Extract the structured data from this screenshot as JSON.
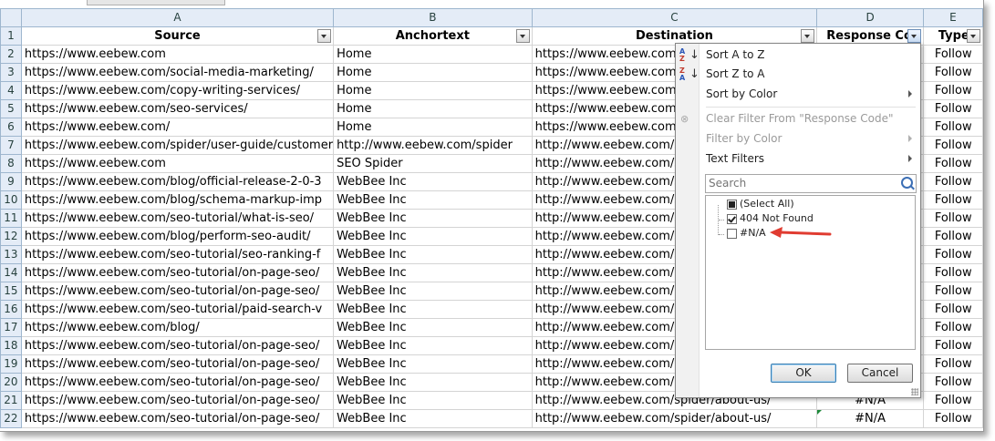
{
  "columns": [
    "",
    "A",
    "B",
    "C",
    "D",
    "E"
  ],
  "header_row": {
    "number": "1",
    "source": "Source",
    "anchortext": "Anchortext",
    "destination": "Destination",
    "response_code": "Response Cod",
    "type": "Type"
  },
  "rows": [
    {
      "n": "2",
      "a": "https://www.eebew.com",
      "b": "Home",
      "c": "https://www.eebew.com/",
      "d": "",
      "e": "Follow"
    },
    {
      "n": "3",
      "a": "https://www.eebew.com/social-media-marketing/",
      "b": "Home",
      "c": "https://www.eebew.com/",
      "d": "",
      "e": "Follow"
    },
    {
      "n": "4",
      "a": "https://www.eebew.com/copy-writing-services/",
      "b": "Home",
      "c": "https://www.eebew.com/",
      "d": "",
      "e": "Follow"
    },
    {
      "n": "5",
      "a": "https://www.eebew.com/seo-services/",
      "b": "Home",
      "c": "https://www.eebew.com/",
      "d": "",
      "e": "Follow"
    },
    {
      "n": "6",
      "a": "https://www.eebew.com/",
      "b": "Home",
      "c": "https://www.eebew.com/",
      "d": "",
      "e": "Follow"
    },
    {
      "n": "7",
      "a": "https://www.eebew.com/spider/user-guide/customer",
      "b": "http://www.eebew.com/spider",
      "c": "http://www.eebew.com/s",
      "d": "",
      "e": "Follow"
    },
    {
      "n": "8",
      "a": "https://www.eebew.com",
      "b": "SEO Spider",
      "c": "http://www.eebew.com/s",
      "d": "",
      "e": "Follow"
    },
    {
      "n": "9",
      "a": "https://www.eebew.com/blog/official-release-2-0-3",
      "b": "WebBee Inc",
      "c": "http://www.eebew.com/s",
      "d": "",
      "e": "Follow"
    },
    {
      "n": "10",
      "a": "https://www.eebew.com/blog/schema-markup-imp",
      "b": "WebBee Inc",
      "c": "http://www.eebew.com/s",
      "d": "",
      "e": "Follow"
    },
    {
      "n": "11",
      "a": "https://www.eebew.com/seo-tutorial/what-is-seo/",
      "b": "WebBee Inc",
      "c": "http://www.eebew.com/s",
      "d": "",
      "e": "Follow"
    },
    {
      "n": "12",
      "a": "https://www.eebew.com/blog/perform-seo-audit/",
      "b": "WebBee Inc",
      "c": "http://www.eebew.com/s",
      "d": "",
      "e": "Follow"
    },
    {
      "n": "13",
      "a": "https://www.eebew.com/seo-tutorial/seo-ranking-f",
      "b": "WebBee Inc",
      "c": "http://www.eebew.com/s",
      "d": "",
      "e": "Follow"
    },
    {
      "n": "14",
      "a": "https://www.eebew.com/seo-tutorial/on-page-seo/",
      "b": "WebBee Inc",
      "c": "http://www.eebew.com/",
      "d": "",
      "e": "Follow"
    },
    {
      "n": "15",
      "a": "https://www.eebew.com/seo-tutorial/on-page-seo/",
      "b": "WebBee Inc",
      "c": "http://www.eebew.com/",
      "d": "",
      "e": "Follow"
    },
    {
      "n": "16",
      "a": "https://www.eebew.com/seo-tutorial/paid-search-v",
      "b": "WebBee Inc",
      "c": "http://www.eebew.com/s",
      "d": "",
      "e": "Follow"
    },
    {
      "n": "17",
      "a": "https://www.eebew.com/blog/",
      "b": "WebBee Inc",
      "c": "http://www.eebew.com/s",
      "d": "",
      "e": "Follow"
    },
    {
      "n": "18",
      "a": "https://www.eebew.com/seo-tutorial/on-page-seo/",
      "b": "WebBee Inc",
      "c": "http://www.eebew.com/",
      "d": "",
      "e": "Follow"
    },
    {
      "n": "19",
      "a": "https://www.eebew.com/seo-tutorial/on-page-seo/",
      "b": "WebBee Inc",
      "c": "http://www.eebew.com/",
      "d": "",
      "e": "Follow"
    },
    {
      "n": "20",
      "a": "https://www.eebew.com/seo-tutorial/on-page-seo/",
      "b": "WebBee Inc",
      "c": "http://www.eebew.com/",
      "d": "",
      "e": "Follow"
    },
    {
      "n": "21",
      "a": "https://www.eebew.com/seo-tutorial/on-page-seo/",
      "b": "WebBee Inc",
      "c": "http://www.eebew.com/spider/about-us/",
      "d": "#N/A",
      "e": "Follow"
    },
    {
      "n": "22",
      "a": "https://www.eebew.com/seo-tutorial/on-page-seo/",
      "b": "WebBee Inc",
      "c": "http://www.eebew.com/spider/about-us/",
      "d": "#N/A",
      "e": "Follow"
    }
  ],
  "filter_menu": {
    "sort_a_z": "Sort A to Z",
    "sort_z_a": "Sort Z to A",
    "sort_by_color": "Sort by Color",
    "clear_filter": "Clear Filter From \"Response Code\"",
    "filter_by_color": "Filter by Color",
    "text_filters": "Text Filters",
    "search_placeholder": "Search",
    "values": [
      {
        "label": "(Select All)",
        "state": "partial"
      },
      {
        "label": "404 Not Found",
        "state": "checked"
      },
      {
        "label": "#N/A",
        "state": "unchecked"
      }
    ],
    "ok_label": "OK",
    "cancel_label": "Cancel"
  },
  "colors": {
    "header_bg": "#e4ecf7",
    "grid_line": "#d4d4d4",
    "annotation_arrow": "#e03c31"
  }
}
